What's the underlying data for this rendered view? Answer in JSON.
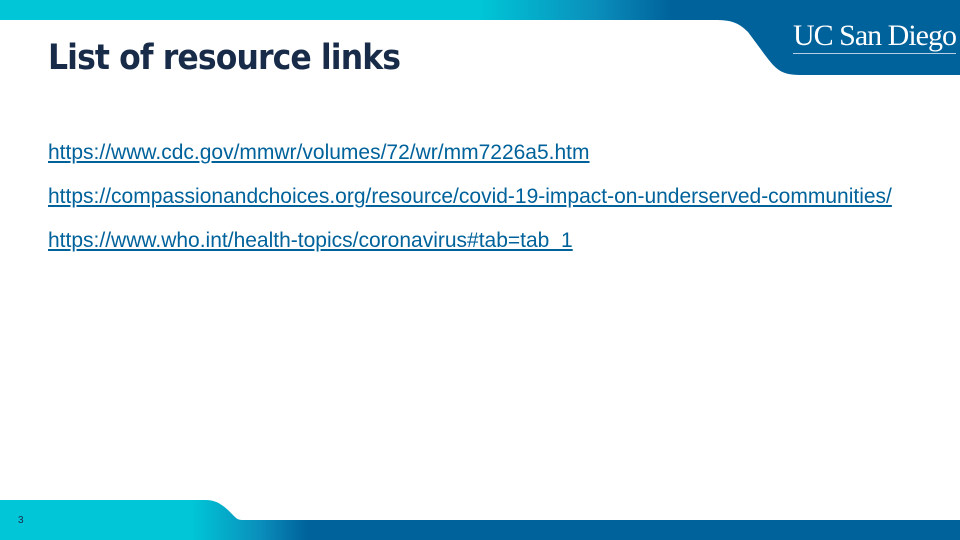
{
  "slide": {
    "title": "List of resource links",
    "logo_text": "UC San Diego",
    "links": [
      "https://www.cdc.gov/mmwr/volumes/72/wr/mm7226a5.htm",
      "https://compassionandchoices.org/resource/covid-19-impact-on-underserved-communities/",
      "https://www.who.int/health-topics/coronavirus#tab=tab_1"
    ],
    "page_number": "3"
  },
  "colors": {
    "navy": "#182b49",
    "blue": "#00629b",
    "cyan": "#00c6d7",
    "link": "#00629b"
  }
}
